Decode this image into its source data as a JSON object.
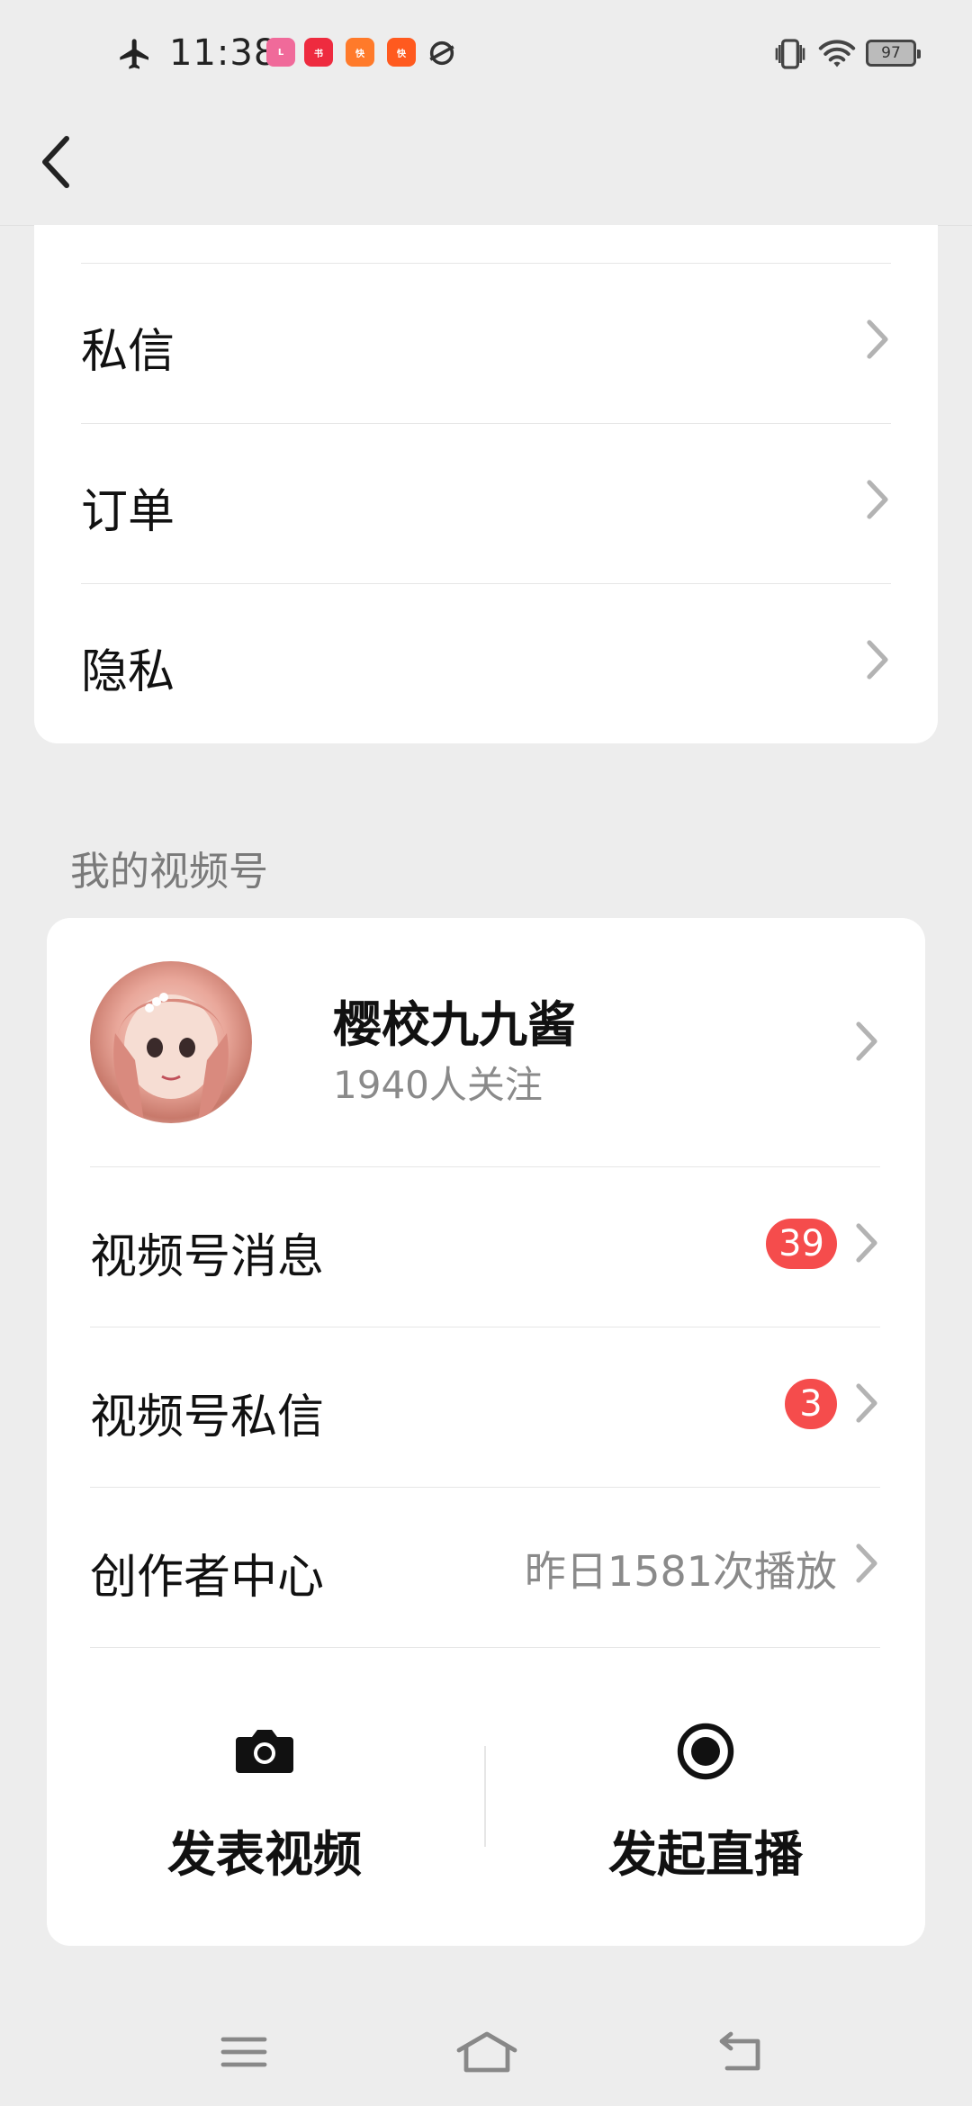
{
  "status_bar": {
    "time": "11:38",
    "battery": "97",
    "app_badges": [
      {
        "text": "Lofter",
        "color": "#f06a9a"
      },
      {
        "text": "小红书",
        "color": "#ee2b3f"
      },
      {
        "text": "快",
        "color": "#ff7a2a"
      },
      {
        "text": "快",
        "color": "#ff5a1f"
      }
    ]
  },
  "header": {
    "back_icon": "chevron-left-icon"
  },
  "menu_items": [
    {
      "label": "私信"
    },
    {
      "label": "订单"
    },
    {
      "label": "隐私"
    }
  ],
  "channels": {
    "section_title": "我的视频号",
    "profile": {
      "name": "樱校九九酱",
      "followers": "1940人关注"
    },
    "rows": [
      {
        "label": "视频号消息",
        "badge": "39"
      },
      {
        "label": "视频号私信",
        "badge": "3"
      },
      {
        "label": "创作者中心",
        "sub": "昨日1581次播放"
      }
    ],
    "actions": [
      {
        "label": "发表视频",
        "icon": "camera-icon"
      },
      {
        "label": "发起直播",
        "icon": "live-record-icon"
      }
    ]
  },
  "nav_bar": {
    "menu_icon": "menu-icon",
    "home_icon": "home-icon",
    "back_icon": "back-icon"
  },
  "colors": {
    "badge": "#f54c4c",
    "background": "#ededed"
  }
}
